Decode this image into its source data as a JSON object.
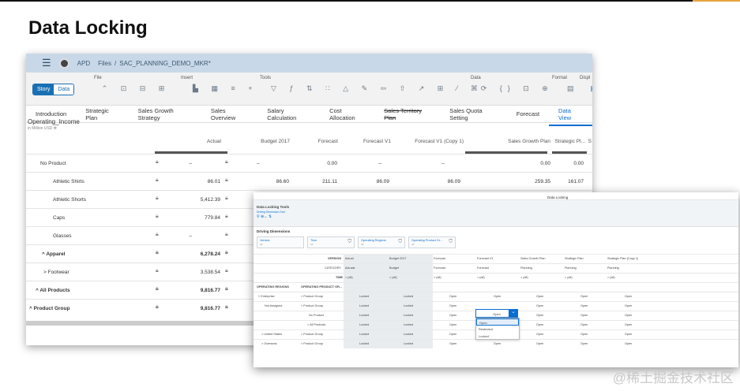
{
  "slide": {
    "title": "Data Locking"
  },
  "app": {
    "user": "APD",
    "files": "Files",
    "sep": "/",
    "file_name": "SAC_PLANNING_DEMO_MKR*",
    "toggle": {
      "story": "Story",
      "data": "Data"
    },
    "groups": {
      "file": "File",
      "insert": "Insert",
      "tools": "Tools",
      "data": "Data",
      "format": "Format",
      "display": "Displ"
    },
    "tabs": [
      "Introduction",
      "Strategic Plan",
      "Sales Growth Strategy",
      "Sales Overview",
      "Salary Calculation",
      "Cost Allocation",
      "Sales Territory Plan",
      "Sales Quota Setting",
      "Forecast",
      "Data View"
    ],
    "active_tab": "Data View",
    "table": {
      "title": "Operating_Income",
      "subtitle": "in Million USD",
      "columns": [
        "Actual",
        "Budget 2017",
        "Forecast",
        "Forecast V1",
        "Forecast V1 (Copy 1)",
        "Sales Growth Plan",
        "Strategic Pl...",
        "S"
      ],
      "rows": [
        {
          "label": "No Product",
          "actual": "–",
          "budget": "–",
          "forecast": "0.00",
          "fv1": "–",
          "fv1c": "–",
          "sgp": "0.00",
          "sp": "0.00"
        },
        {
          "label": "Athletic Shirts",
          "actual": "86.01",
          "budget": "86.60",
          "forecast": "211.11",
          "fv1": "86.09",
          "fv1c": "86.09",
          "sgp": "259.35",
          "sp": "161.07"
        },
        {
          "label": "Athletic Shorts",
          "actual": "5,412.39",
          "budget": "",
          "forecast": "",
          "fv1": "",
          "fv1c": "",
          "sgp": "",
          "sp": ""
        },
        {
          "label": "Caps",
          "actual": "779.84",
          "budget": "",
          "forecast": "",
          "fv1": "",
          "fv1c": "",
          "sgp": "",
          "sp": ""
        },
        {
          "label": "Glasses",
          "actual": "–",
          "budget": "",
          "forecast": "",
          "fv1": "",
          "fv1c": "",
          "sgp": "",
          "sp": ""
        },
        {
          "label": "^ Apparel",
          "actual": "6,278.24",
          "budget": "",
          "forecast": "",
          "fv1": "",
          "fv1c": "",
          "sgp": "",
          "sp": ""
        },
        {
          "label": "> Footwear",
          "actual": "3,538.54",
          "budget": "",
          "forecast": "",
          "fv1": "",
          "fv1c": "",
          "sgp": "",
          "sp": ""
        },
        {
          "label": "^ All Products",
          "actual": "9,816.77",
          "budget": "",
          "forecast": "",
          "fv1": "",
          "fv1c": "",
          "sgp": "",
          "sp": ""
        },
        {
          "label": "^ Product Group",
          "actual": "9,816.77",
          "budget": "",
          "forecast": "",
          "fv1": "",
          "fv1c": "",
          "sgp": "",
          "sp": ""
        }
      ]
    }
  },
  "dialog": {
    "title": "Data Locking",
    "tools_title": "Data Locking Tools",
    "tools_sub": "Driving Dimension   Sort",
    "driving_title": "Driving Dimensions",
    "dims": [
      {
        "label": "Version",
        "sub": "All"
      },
      {
        "label": "Time",
        "sub": "All"
      },
      {
        "label": "Operating Regions",
        "sub": "All"
      },
      {
        "label": "Operating Product Gr...",
        "sub": "All"
      }
    ],
    "version_label": "VERSION",
    "category_label": "CATEGORY",
    "time_label": "TIME",
    "versions": [
      "Actual",
      "Budget 2017",
      "Forecast",
      "Forecast V1",
      "Sales Growth Plan",
      "Strategic Plan",
      "Strategic Plan (Copy 1)"
    ],
    "categories": [
      "Actuals",
      "Budget",
      "Forecast",
      "Forecast",
      "Planning",
      "Planning",
      "Planning"
    ],
    "time": "> (all)",
    "row_headers": [
      "OPERATING REGIONS",
      "OPERATING PRODUCT GR..."
    ],
    "rows": [
      {
        "region": "˅ Enterprise",
        "product": "> Product Group",
        "cells": [
          "Locked",
          "Locked",
          "Open",
          "Open",
          "Open",
          "Open",
          "Open"
        ]
      },
      {
        "region": "Not Assigned",
        "product": "˅ Product Group",
        "cells": [
          "Locked",
          "Locked",
          "Open",
          "Open",
          "Open",
          "Open",
          "Open"
        ]
      },
      {
        "region": "",
        "product": "No Product",
        "cells": [
          "Locked",
          "Locked",
          "Open",
          "",
          "Open",
          "Open",
          "Open"
        ]
      },
      {
        "region": "",
        "product": "> All Products",
        "cells": [
          "Locked",
          "Locked",
          "Open",
          "",
          "Open",
          "Open",
          "Open"
        ]
      },
      {
        "region": "> United States",
        "product": "> Product Group",
        "cells": [
          "Locked",
          "Locked",
          "Open",
          "Open",
          "Open",
          "Open",
          "Open"
        ]
      },
      {
        "region": "> Overseas",
        "product": "> Product Group",
        "cells": [
          "Locked",
          "Locked",
          "Open",
          "Open",
          "Open",
          "Open",
          "Open"
        ]
      }
    ],
    "dropdown_value": "Open",
    "dropdown_options": [
      "Open",
      "Restricted",
      "Locked"
    ]
  },
  "watermark": "@稀土掘金技术社区"
}
